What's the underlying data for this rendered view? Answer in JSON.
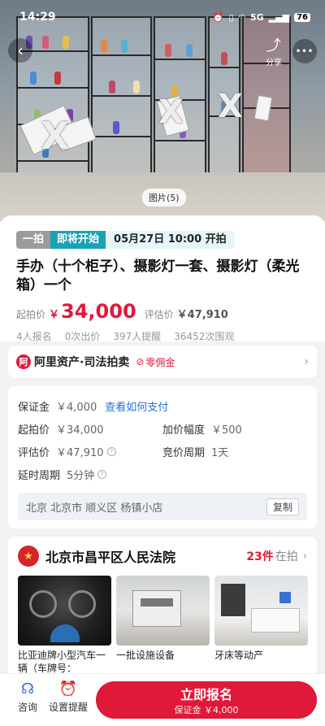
{
  "status_bar": {
    "time": "14:29",
    "network": "5G",
    "battery": "76"
  },
  "hero": {
    "photo_counter": "图片(5)",
    "share_label": "分享",
    "more_glyph": "•••"
  },
  "lot": {
    "tag_first": "一拍",
    "tag_status": "即将开始",
    "start_time": "05月27日 10:00 开拍",
    "title": "手办（十个柜子）、摄影灯一套、摄影灯（柔光箱）一个",
    "start_price_label": "起拍价",
    "currency": "￥",
    "start_price": "34,000",
    "eval_label": "评估价",
    "eval_price": "￥47,910",
    "stats": [
      "4人报名",
      "0次出价",
      "397人提醒",
      "36452次围观"
    ]
  },
  "platform": {
    "logo_char": "阿",
    "name": "阿里资产·司法拍卖",
    "fee_label": "零佣金"
  },
  "details": {
    "deposit_label": "保证金",
    "deposit_value": "￥4,000",
    "pay_link": "查看如何支付",
    "start_label": "起拍价",
    "start_value": "￥34,000",
    "increment_label": "加价幅度",
    "increment_value": "￥500",
    "eval_label": "评估价",
    "eval_value": "￥47,910",
    "cycle_label": "竞价周期",
    "cycle_value": "1天",
    "delay_label": "延时周期",
    "delay_value": "5分钟",
    "address": "北京 北京市 顺义区 杨镇小店",
    "copy_label": "复制"
  },
  "court": {
    "name": "北京市昌平区人民法院",
    "count": "23件",
    "count_label": "在拍",
    "lots": [
      {
        "title": "比亚迪牌小型汽车一辆（车牌号："
      },
      {
        "title": "一批设施设备"
      },
      {
        "title": "牙床等动产"
      }
    ]
  },
  "bottom_bar": {
    "consult_label": "咨询",
    "remind_label": "设置提醒",
    "signup_label": "立即报名",
    "signup_sub": "保证金 ￥4,000"
  }
}
